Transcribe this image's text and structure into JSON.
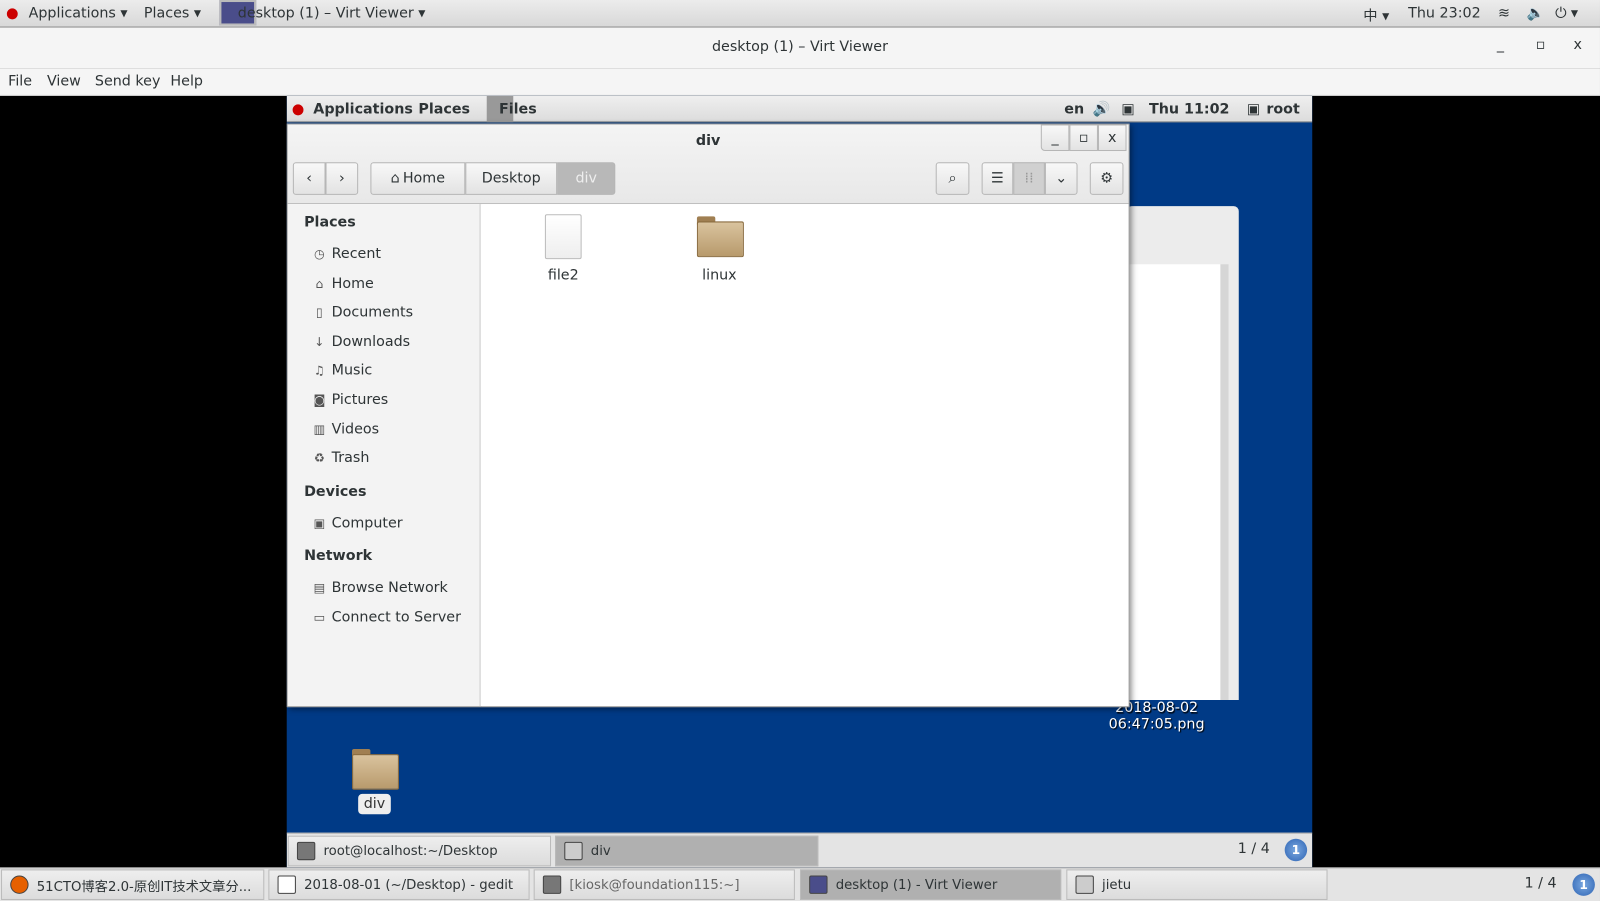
{
  "host_panel": {
    "applications": "Applications ▾",
    "places": "Places ▾",
    "window_title": "desktop (1) – Virt Viewer ▾",
    "input_method": "中 ▾",
    "clock": "Thu 23:02",
    "power": "⏻ ▾"
  },
  "viewer": {
    "title": "desktop (1) – Virt Viewer",
    "menu": [
      "File",
      "View",
      "Send key",
      "Help"
    ],
    "controls": [
      "_",
      "▫",
      "x"
    ]
  },
  "guest_panel": {
    "applications": "Applications",
    "places": "Places",
    "files": "Files",
    "lang": "en",
    "clock": "Thu 11:02",
    "user": "root"
  },
  "files_window": {
    "title": "div",
    "breadcrumbs": [
      "Home",
      "Desktop",
      "div"
    ],
    "sidebar": {
      "sections": [
        {
          "title": "Places",
          "items": [
            {
              "label": "Recent",
              "icon": "clock-icon"
            },
            {
              "label": "Home",
              "icon": "home-icon"
            },
            {
              "label": "Documents",
              "icon": "document-icon"
            },
            {
              "label": "Downloads",
              "icon": "download-icon"
            },
            {
              "label": "Music",
              "icon": "music-icon"
            },
            {
              "label": "Pictures",
              "icon": "camera-icon"
            },
            {
              "label": "Videos",
              "icon": "film-icon"
            },
            {
              "label": "Trash",
              "icon": "trash-icon"
            }
          ]
        },
        {
          "title": "Devices",
          "items": [
            {
              "label": "Computer",
              "icon": "drive-icon"
            }
          ]
        },
        {
          "title": "Network",
          "items": [
            {
              "label": "Browse Network",
              "icon": "network-icon"
            },
            {
              "label": "Connect to Server",
              "icon": "server-icon"
            }
          ]
        }
      ]
    },
    "items": [
      {
        "name": "file2",
        "type": "file"
      },
      {
        "name": "linux",
        "type": "folder"
      }
    ]
  },
  "guest_desktop": {
    "bg_file": [
      "2018-08-02",
      "06:47:05.png"
    ],
    "folder": "div"
  },
  "guest_taskbar": {
    "tasks": [
      "root@localhost:~/Desktop",
      "div"
    ],
    "active": 1,
    "pager": "1 / 4",
    "workspace": "1"
  },
  "host_taskbar": {
    "tasks": [
      "51CTO博客2.0-原创IT技术文章分...",
      "2018-08-01 (~/Desktop) - gedit",
      "[kiosk@foundation115:~]",
      "desktop (1) - Virt Viewer",
      "jietu"
    ],
    "active": 3,
    "pager": "1 / 4",
    "workspace": "1"
  },
  "colors": {
    "desktop_bg": "#003a86",
    "accent": "#2d63b3"
  }
}
